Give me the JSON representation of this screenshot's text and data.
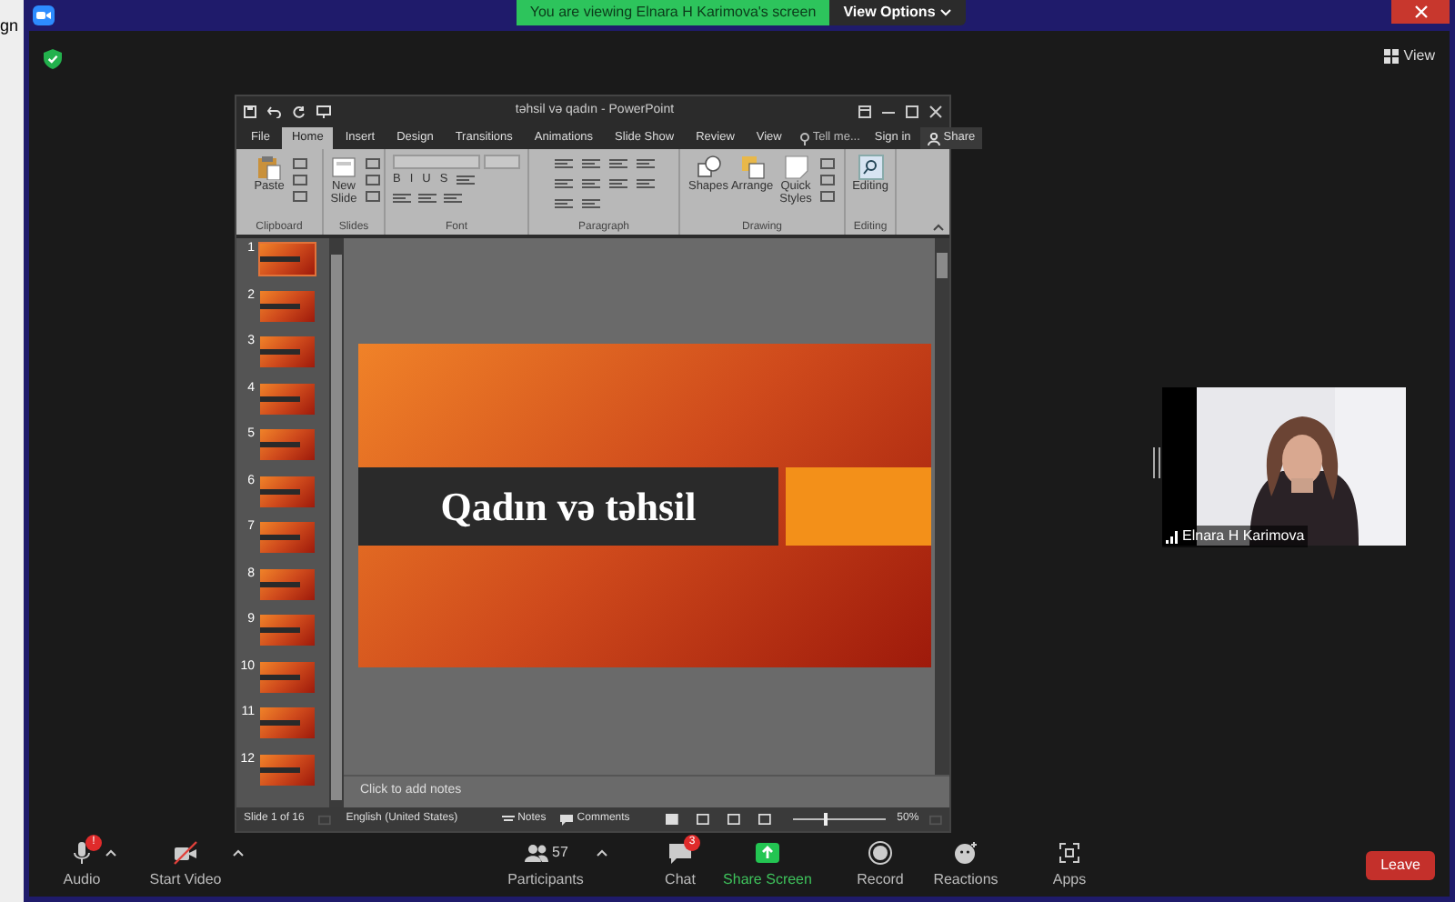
{
  "left_edge_text": "gn",
  "banner": {
    "text": "You are viewing Elnara H Karimova's screen",
    "view_options": "View Options"
  },
  "view_button": "View",
  "powerpoint": {
    "title": "təhsil və qadın - PowerPoint",
    "tabs": [
      {
        "label": "File",
        "selected": false
      },
      {
        "label": "Home",
        "selected": true
      },
      {
        "label": "Insert",
        "selected": false
      },
      {
        "label": "Design",
        "selected": false
      },
      {
        "label": "Transitions",
        "selected": false
      },
      {
        "label": "Animations",
        "selected": false
      },
      {
        "label": "Slide Show",
        "selected": false
      },
      {
        "label": "Review",
        "selected": false
      },
      {
        "label": "View",
        "selected": false
      }
    ],
    "tell_me": "Tell me...",
    "sign_in": "Sign in",
    "share": "Share",
    "ribbon_groups": [
      {
        "kind": "clipboard",
        "label": "Clipboard",
        "buttons": [
          "Paste"
        ]
      },
      {
        "kind": "slides",
        "label": "Slides",
        "buttons": [
          "New Slide"
        ]
      },
      {
        "kind": "font",
        "label": "Font",
        "buttons": [
          "B",
          "I",
          "U",
          "S"
        ]
      },
      {
        "kind": "paragraph",
        "label": "Paragraph"
      },
      {
        "kind": "drawing",
        "label": "Drawing",
        "buttons": [
          "Shapes",
          "Arrange",
          "Quick Styles"
        ]
      },
      {
        "kind": "editing",
        "label": "Editing",
        "buttons": [
          "Editing"
        ]
      }
    ],
    "thumbnails": [
      {
        "number": "1",
        "selected": true
      },
      {
        "number": "2",
        "selected": false
      },
      {
        "number": "3",
        "selected": false
      },
      {
        "number": "4",
        "selected": false
      },
      {
        "number": "5",
        "selected": false
      },
      {
        "number": "6",
        "selected": false
      },
      {
        "number": "7",
        "selected": false
      },
      {
        "number": "8",
        "selected": false
      },
      {
        "number": "9",
        "selected": false
      },
      {
        "number": "10",
        "selected": false
      },
      {
        "number": "11",
        "selected": false
      },
      {
        "number": "12",
        "selected": false
      }
    ],
    "slide": {
      "title": "Qadın və təhsil"
    },
    "notes_placeholder": "Click to add notes",
    "status": {
      "slide_count": "Slide 1 of 16",
      "language": "English (United States)",
      "notes": "Notes",
      "comments": "Comments",
      "zoom": "50%",
      "level": 0.3
    }
  },
  "video_tile": {
    "name": "Elnara H Karimova"
  },
  "toolbar": {
    "items": [
      {
        "kind": "audio",
        "label": "Audio",
        "badge": "!",
        "menu": true
      },
      {
        "kind": "video",
        "label": "Start Video",
        "menu": true
      },
      {
        "kind": "participants",
        "label": "Participants",
        "count": "57",
        "menu": true
      },
      {
        "kind": "chat",
        "label": "Chat",
        "badge": "3",
        "menu": false
      },
      {
        "kind": "share",
        "label": "Share Screen",
        "menu": false
      },
      {
        "kind": "record",
        "label": "Record",
        "menu": false
      },
      {
        "kind": "reactions",
        "label": "Reactions",
        "menu": false
      },
      {
        "kind": "apps",
        "label": "Apps",
        "menu": false
      }
    ],
    "leave": "Leave"
  }
}
